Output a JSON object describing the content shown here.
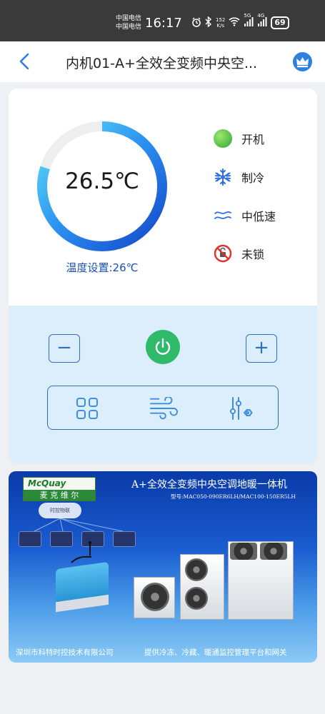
{
  "status_bar": {
    "carrier_1": "中国电信",
    "carrier_2": "中国电信",
    "time": "16:17",
    "net_speed_value": "152",
    "net_speed_unit": "K/s",
    "signal_1_label": "5G",
    "signal_2_label": "4G",
    "battery": "69"
  },
  "header": {
    "title": "内机01-A+全效全变频中央空..."
  },
  "thermostat": {
    "current_temp": "26.5℃",
    "setpoint_label": "温度设置:26℃",
    "dial_fill_fraction": 0.8
  },
  "status": {
    "power": "开机",
    "mode": "制冷",
    "fan_speed": "中低速",
    "lock": "未锁"
  },
  "controls": {
    "decrease_symbol": "−",
    "increase_symbol": "+"
  },
  "banner": {
    "logo_en": "McQuay",
    "logo_cn": "麦 克 维 尔",
    "title": "A+全效全变频中央空调地暖一体机",
    "model": "型号:MAC050-090ER6LH/MAC100-150ER5LH",
    "cloud_label": "时控物联",
    "footer_company": "深圳市科特时控技术有限公司",
    "footer_service": "提供冷冻、冷藏、暖通监控管理平台和网关"
  },
  "colors": {
    "accent": "#2f6fc2",
    "power_green": "#2fba6a",
    "setpoint_text": "#1a4fb4"
  }
}
